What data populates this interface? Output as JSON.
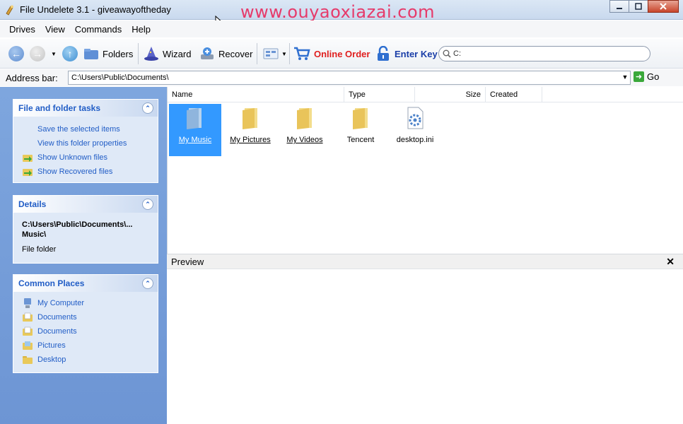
{
  "window": {
    "title": "File Undelete 3.1 - giveawayoftheday",
    "watermark": "www.ouyaoxiazai.com"
  },
  "menu": [
    "Drives",
    "View",
    "Commands",
    "Help"
  ],
  "toolbar": {
    "folders_label": "Folders",
    "wizard_label": "Wizard",
    "recover_label": "Recover",
    "online_order_label": "Online Order",
    "enter_key_label": "Enter Key",
    "search_value": "C:"
  },
  "address": {
    "label": "Address bar:",
    "value": "C:\\Users\\Public\\Documents\\",
    "go_label": "Go"
  },
  "panels": {
    "tasks": {
      "title": "File and folder tasks",
      "items": [
        "Save the selected items",
        "View this folder properties",
        "Show Unknown files",
        "Show Recovered files"
      ]
    },
    "details": {
      "title": "Details",
      "path": "C:\\Users\\Public\\Documents\\... Music\\",
      "type": "File folder"
    },
    "places": {
      "title": "Common Places",
      "items": [
        "My Computer",
        "Documents",
        "Documents",
        "Pictures",
        "Desktop"
      ]
    }
  },
  "columns": [
    "Name",
    "Type",
    "Size",
    "Created"
  ],
  "files": [
    {
      "name": "My Music",
      "icon": "blue-folder-icon",
      "selected": true
    },
    {
      "name": "My Pictures",
      "icon": "folder-icon",
      "selected": false
    },
    {
      "name": "My Videos",
      "icon": "folder-icon",
      "selected": false
    },
    {
      "name": "Tencent",
      "icon": "folder-icon",
      "selected": false
    },
    {
      "name": "desktop.ini",
      "icon": "settings-file-icon",
      "selected": false
    }
  ],
  "preview": {
    "title": "Preview"
  },
  "colors": {
    "accent": "#215dc6",
    "selection": "#3399ff",
    "online_order": "#e02020",
    "enter_key": "#1a3ea8"
  }
}
